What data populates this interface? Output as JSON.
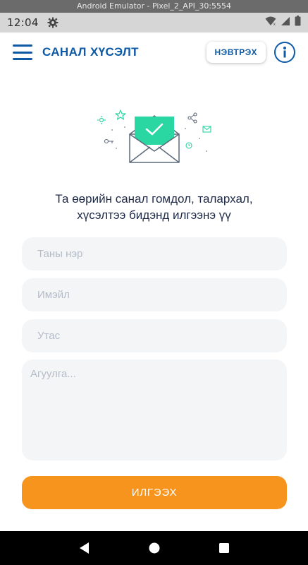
{
  "emulator": {
    "title": "Android Emulator - Pixel_2_API_30:5554"
  },
  "status_bar": {
    "time": "12:04",
    "icons": [
      "settings-icon",
      "wifi-icon",
      "signal-icon",
      "battery-icon"
    ]
  },
  "app_bar": {
    "title": "САНАЛ ХҮСЭЛТ",
    "login_label": "НЭВТРЭХ",
    "menu_icon": "menu-icon",
    "info_icon": "info-icon"
  },
  "intro": {
    "line1": "Та өөрийн санал гомдол, талархал,",
    "line2": "хүсэлтээ бидэнд илгээнэ үү"
  },
  "form": {
    "name_placeholder": "Таны нэр",
    "email_placeholder": "Имэйл",
    "phone_placeholder": "Утас",
    "content_placeholder": "Агуулга...",
    "submit_label": "ИЛГЭЭХ"
  },
  "colors": {
    "brand_blue": "#0e5aa7",
    "accent_orange": "#f7941d",
    "accent_green": "#2ad6a2",
    "field_bg": "#f4f5f7",
    "placeholder": "#b3bcc8"
  }
}
